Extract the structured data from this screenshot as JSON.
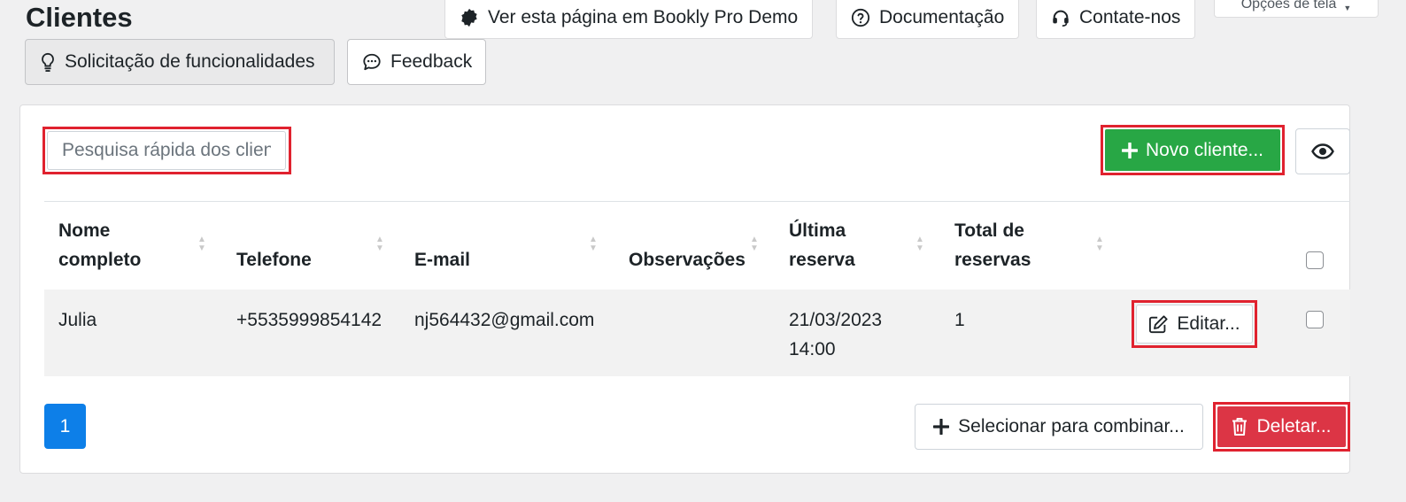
{
  "page": {
    "title": "Clientes"
  },
  "top_buttons": {
    "demo": "Ver esta página em Bookly Pro Demo",
    "docs": "Documentação",
    "contact": "Contate-nos",
    "screen_options": "Opções de tela"
  },
  "sub_buttons": {
    "feature_request": "Solicitação de funcionalidades",
    "feedback": "Feedback"
  },
  "toolbar": {
    "search_placeholder": "Pesquisa rápida dos cliente",
    "new_client": "Novo cliente..."
  },
  "table": {
    "columns": {
      "name": [
        "Nome",
        "completo"
      ],
      "phone": "Telefone",
      "email": "E-mail",
      "notes": "Observações",
      "last_booking": [
        "Última",
        "reserva"
      ],
      "total": [
        "Total de",
        "reservas"
      ]
    },
    "rows": [
      {
        "name": "Julia",
        "phone": "+5535999854142",
        "email": "nj564432@gmail.com",
        "notes": "",
        "last_booking_date": "21/03/2023",
        "last_booking_time": "14:00",
        "total": "1",
        "edit_label": "Editar..."
      }
    ]
  },
  "footer": {
    "page": "1",
    "merge": "Selecionar para combinar...",
    "delete": "Deletar..."
  },
  "colors": {
    "success": "#28a745",
    "danger": "#dc3545",
    "primary": "#0d7fe8",
    "highlight": "#e0222f"
  },
  "icons": [
    "badge-icon",
    "question-circle-icon",
    "headset-icon",
    "lightbulb-icon",
    "chat-icon",
    "plus-icon",
    "eye-icon",
    "sort-icon",
    "edit-icon",
    "trash-icon"
  ]
}
